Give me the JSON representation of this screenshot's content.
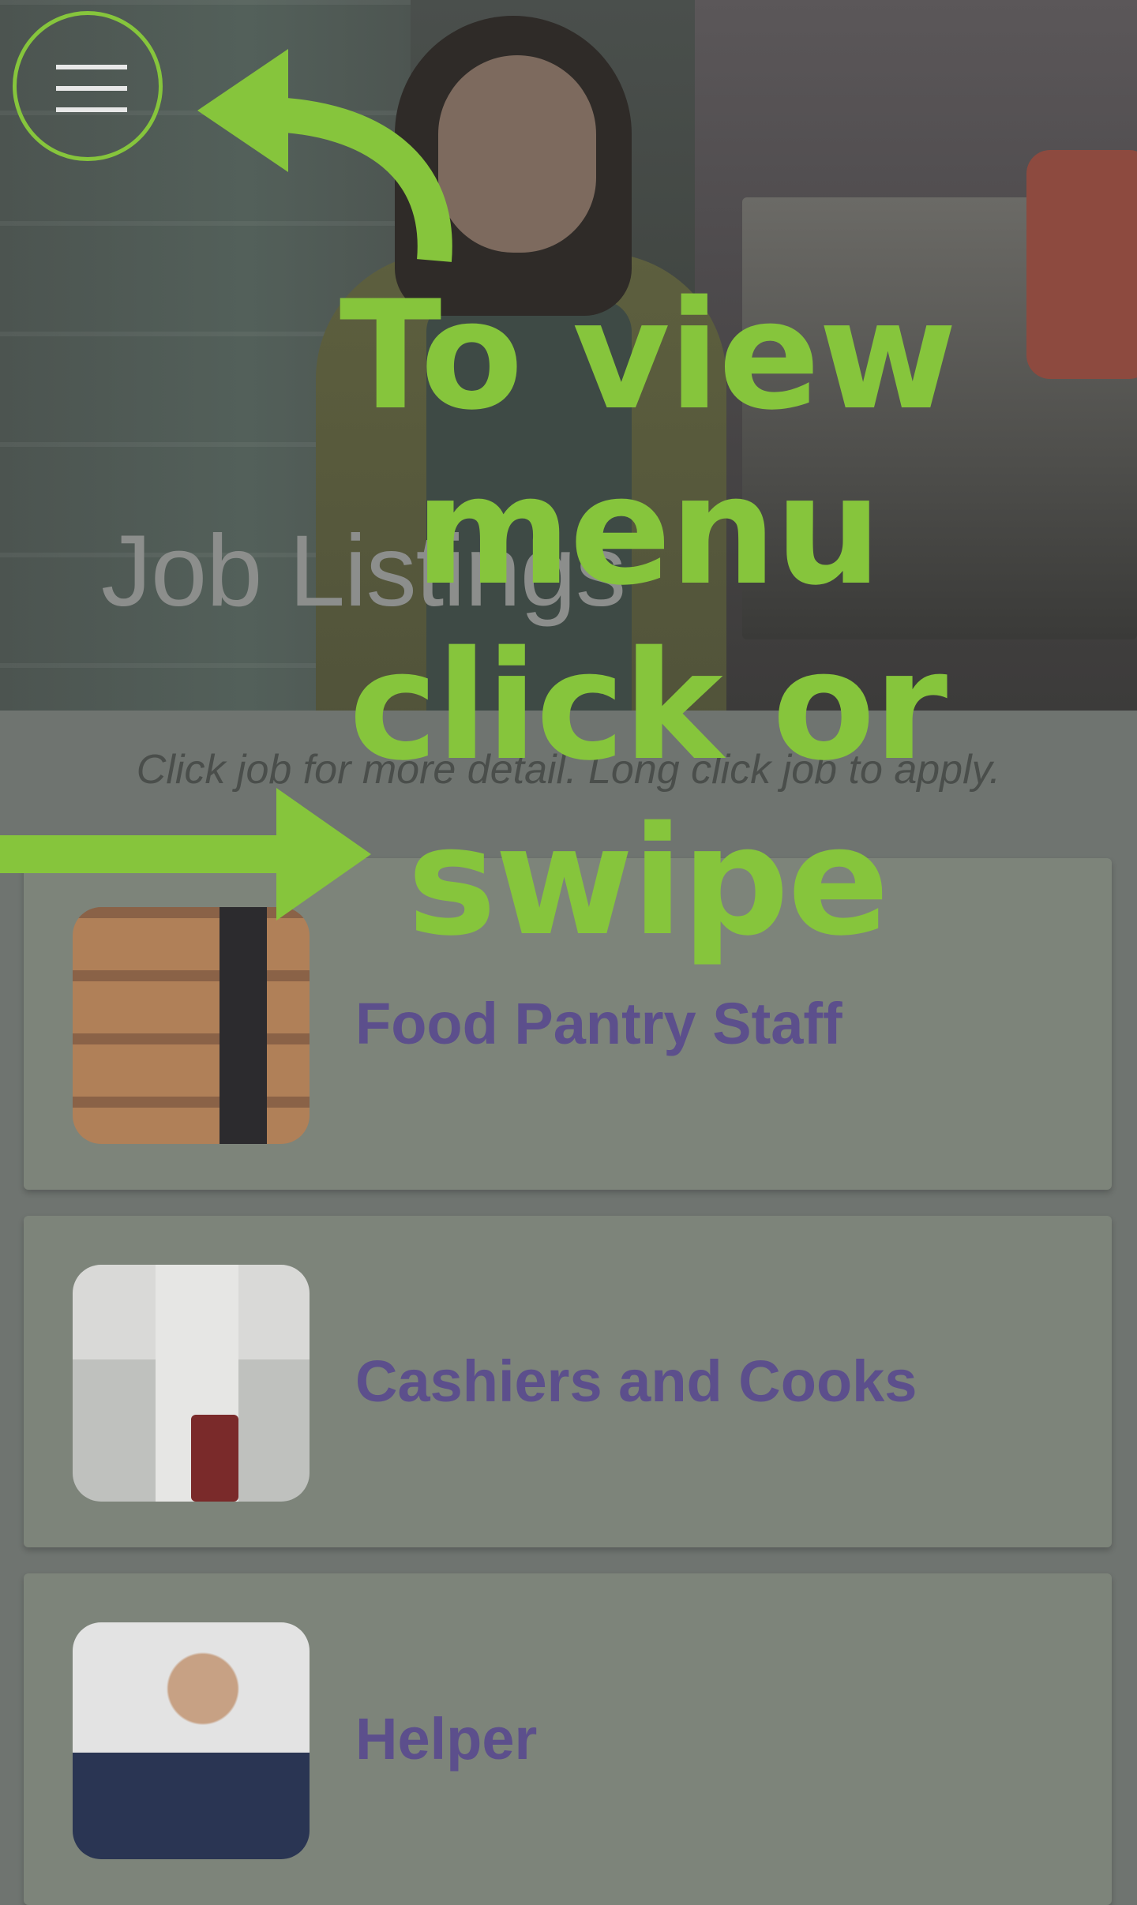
{
  "header": {
    "title": "Job Listings"
  },
  "instructions": "Click job for more detail. Long click job to apply.",
  "jobs": [
    {
      "title": "Food Pantry Staff",
      "image_icon": "food-pantry-photo"
    },
    {
      "title": "Cashiers and Cooks",
      "image_icon": "cashier-photo"
    },
    {
      "title": "Helper",
      "image_icon": "helper-photo"
    }
  ],
  "overlay": {
    "hint_lines": [
      "To view",
      "menu",
      "click or",
      "swipe"
    ],
    "menu_icon": "hamburger-menu-icon",
    "accent_color": "#86c53c"
  },
  "colors": {
    "job_title": "#5c4f8c",
    "card_background": "#7d847a",
    "page_background": "#6f7470"
  }
}
